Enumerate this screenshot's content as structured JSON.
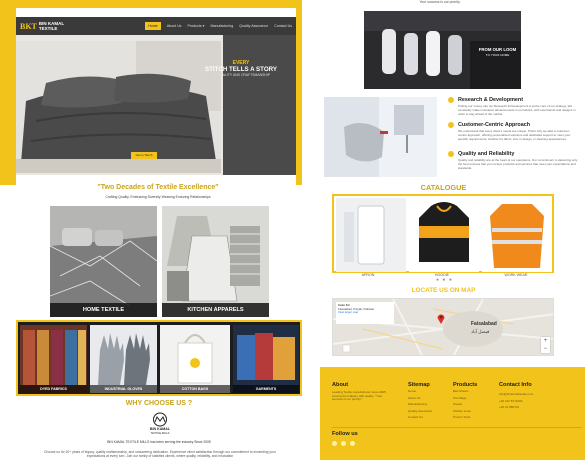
{
  "colors": {
    "accent": "#f2c31b",
    "dark": "#3a3a3a",
    "heading_gold": "#c9a41c"
  },
  "left_page": {
    "nav": {
      "logo_mark": "BKT",
      "logo_name_1": "BIN KAMAL",
      "logo_name_2": "TEXTILE",
      "links": [
        "Home",
        "About Us",
        "Products ▾",
        "Manufacturing",
        "Quality Assurance",
        "Contact Us"
      ]
    },
    "hero": {
      "eyebrow": "EVERY",
      "title": "STITCH TELLS A STORY",
      "subtitle": "OF QUALITY AND CRAFTSMANSHIP",
      "button": "Get in Touch"
    },
    "two_decades": {
      "title": "\"Two Decades of Textile Excellence\"",
      "subtitle": "Crafting Quality, Embracing Diversity Weaving Enduring Relationships"
    },
    "tiles": [
      {
        "label": "HOME TEXTILE"
      },
      {
        "label": "KITCHEN APPARELS"
      }
    ],
    "products": [
      {
        "label": "DYED FABRICS"
      },
      {
        "label": "INDUSTRIAL GLOVES"
      },
      {
        "label": "COTTON BAGS"
      },
      {
        "label": "GARMENTS"
      }
    ],
    "why": {
      "title": "WHY CHOOSE US ?",
      "logo_name": "BIN KAMAL",
      "logo_sub": "TEXTILE MILLS",
      "about_line": "BIN KAMAL TEXTILE MILLS has been serving the industry Since 2005",
      "about_para": "Choose us for 20+ years of legacy, quality craftsmanship, and unwavering dedication. Experience client satisfaction through our commitment to exceeding your expectations at every turn. Join our family of satisfied clients, where quality, reliability, and innovation"
    }
  },
  "right_page": {
    "tagline": "Your success is our priority.",
    "img1_text_1": "FROM OUR LOOM",
    "img1_text_2": "TO YOUR HOME",
    "features": [
      {
        "title": "Research & Development",
        "desc": "Putting our money into our Research & Development is at the core of our strategy. We constantly make innovative advancements in our fabrics, with new blends and designs in order to stay ahead of the market."
      },
      {
        "title": "Customer-Centric Approach",
        "desc": "We understand that every client's needs are unique. That's why we take a customer-centric approach, offering personalized solutions and dedicated support to meet your specific requirements, whether it's fabric, size or design, or cleaning appearances."
      },
      {
        "title": "Quality and Reliability",
        "desc": "Quality and reliability are at the heart of our operations. Our commitment to delivering only the best ensures that you receive products and services that meet your expectations and standards."
      }
    ],
    "catalogue": {
      "title": "CATALOGUE",
      "items": [
        {
          "label": "APRON"
        },
        {
          "label": "HOODIE"
        },
        {
          "label": "WORK WEAR"
        }
      ],
      "dots": "● ● ●"
    },
    "map": {
      "title": "LOCATE US ON MAP",
      "card_line1": "Cebu Kit",
      "card_line2": "Faisalabad, Punjab, Pakistan",
      "card_link": "View larger map",
      "city": "Faisalabad",
      "city_local": "فیصل آباد",
      "zoom_in": "+",
      "zoom_out": "−"
    },
    "footer": {
      "about_title": "About",
      "about_text": "Leading Textile manufacturer since 2005, serving the industry with quality. \"Your success is our priority.\"",
      "sitemap_title": "Sitemap",
      "sitemap": [
        "Home",
        "About Us",
        "Manufacturing",
        "Quality Assurance",
        "Contact Us"
      ],
      "products_title": "Products",
      "products": [
        "Bed Sheets",
        "Tote Bags",
        "Towels",
        "Kitchen Linen",
        "Protect Tools"
      ],
      "contact_title": "Contact Info",
      "contact": [
        "info@binkamaltextile.com",
        "+92 312 8771000",
        "+92 41 880701"
      ],
      "follow": "Follow us"
    }
  }
}
